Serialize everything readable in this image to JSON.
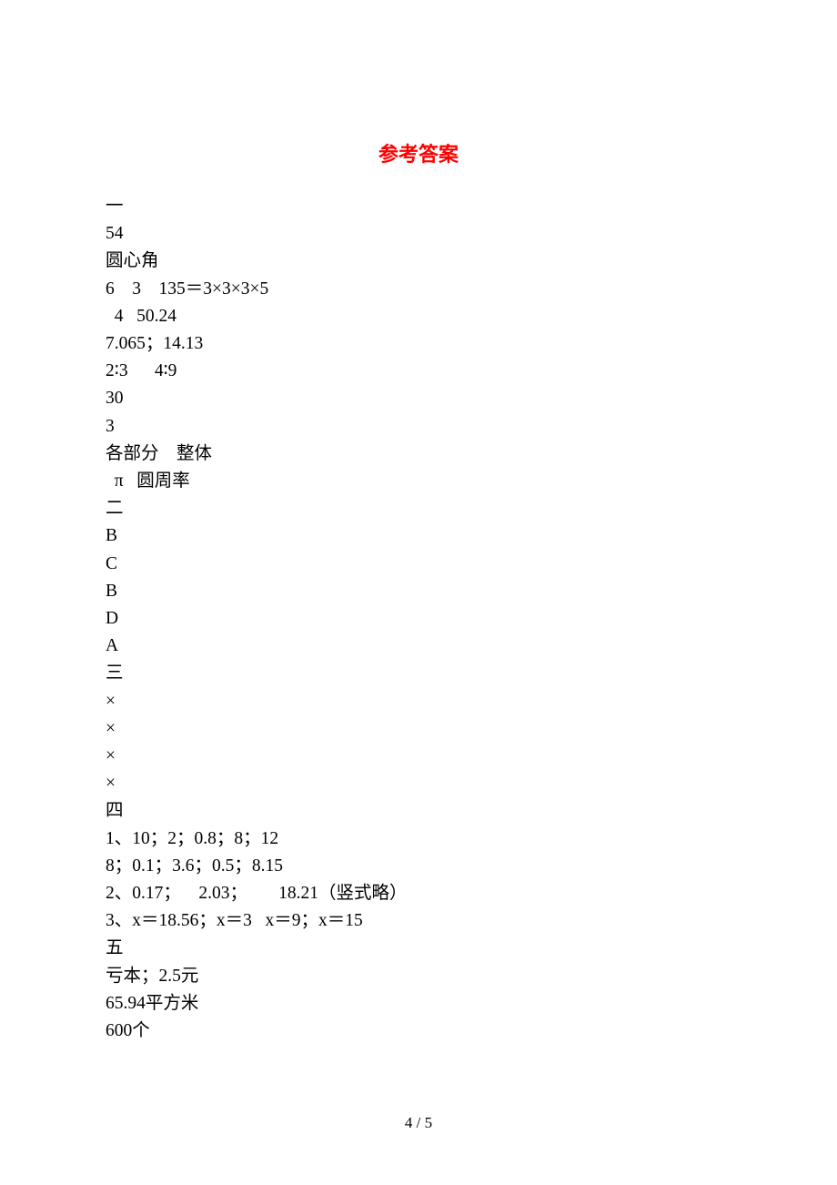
{
  "title": "参考答案",
  "lines": {
    "l1": "一",
    "l2": "54",
    "l3": "圆心角",
    "l4": "6    3    135＝3×3×3×5",
    "l5": "  4   50.24",
    "l6": "7.065；14.13",
    "l7": "2∶3      4∶9",
    "l8": "30",
    "l9": "3",
    "l10": "各部分    整体",
    "l11": "  π   圆周率",
    "l12": "二",
    "l13": "B",
    "l14": "C",
    "l15": "B",
    "l16": "D",
    "l17": "A",
    "l18": "三",
    "l19": "×",
    "l20": "×",
    "l21": "×",
    "l22": "×",
    "l23": "四",
    "l24": "1、10；2；0.8；8；12",
    "l25": "8；0.1；3.6；0.5；8.15",
    "l26": "2、0.17；    2.03；       18.21（竖式略）",
    "l27": "3、x＝18.56；x＝3   x＝9；x＝15",
    "l28": "五",
    "l29": "亏本；2.5元",
    "l30": "65.94平方米",
    "l31": "600个"
  },
  "footer": "4 / 5"
}
